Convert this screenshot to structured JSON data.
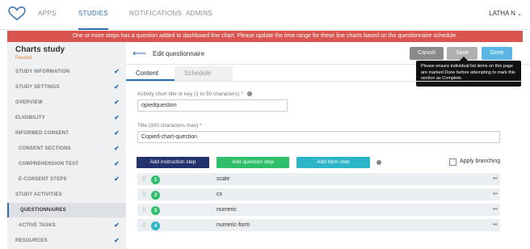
{
  "nav": {
    "items": [
      "APPS",
      "STUDIES",
      "NOTIFICATIONS",
      "ADMINS"
    ],
    "active": "STUDIES",
    "user": "LATHA N"
  },
  "alert": "One or more steps has a question added to dashboard line chart. Please update the time range for these line charts based on the questionnaire schedule.",
  "sidebar": {
    "study_name": "Charts study",
    "study_status": "Paused",
    "items": [
      {
        "label": "STUDY INFORMATION",
        "checked": true
      },
      {
        "label": "STUDY SETTINGS",
        "checked": true
      },
      {
        "label": "OVERVIEW",
        "checked": true
      },
      {
        "label": "ELIGIBILITY",
        "checked": true
      },
      {
        "label": "INFORMED CONSENT",
        "checked": true
      },
      {
        "label": "CONSENT SECTIONS",
        "checked": true
      },
      {
        "label": "COMPREHENSION TEST",
        "checked": true
      },
      {
        "label": "E-CONSENT STEPS",
        "checked": true
      },
      {
        "label": "STUDY ACTIVITIES",
        "checked": false
      },
      {
        "label": "QUESTIONNAIRES",
        "checked": false
      },
      {
        "label": "ACTIVE TASKS",
        "checked": true
      },
      {
        "label": "RESOURCES",
        "checked": true
      }
    ],
    "check_mark": "✔"
  },
  "header": {
    "title": "Edit questionnaire",
    "cancel": "Cancel",
    "save": "Save",
    "done": "Done"
  },
  "tooltip": "Please ensure individual list items on this page are marked Done before attempting to mark this section as Complete.",
  "tabs": {
    "content": "Content",
    "schedule": "Schedule"
  },
  "form": {
    "short_title_label": "Activity short title or key (1 to 50 characters)",
    "short_title_value": "opiedquestion",
    "title_label": "Title (300 characters max)",
    "title_value": "Copied-chart-question",
    "required_mark": "*"
  },
  "buttons": {
    "add_instruction": "Add instruction step",
    "add_question": "Add question step",
    "add_form": "Add form step",
    "apply_branching": "Apply branching"
  },
  "steps": [
    {
      "num": "1",
      "title": "scale",
      "color": "#2fbf6c"
    },
    {
      "num": "2",
      "title": "cs",
      "color": "#2fbf6c"
    },
    {
      "num": "3",
      "title": "numeric",
      "color": "#2fbf6c"
    },
    {
      "num": "4",
      "title": "numeric-form",
      "color": "#2cb4c9"
    }
  ],
  "colors": {
    "accent": "#2b6fb0",
    "alert": "#d9534f"
  }
}
